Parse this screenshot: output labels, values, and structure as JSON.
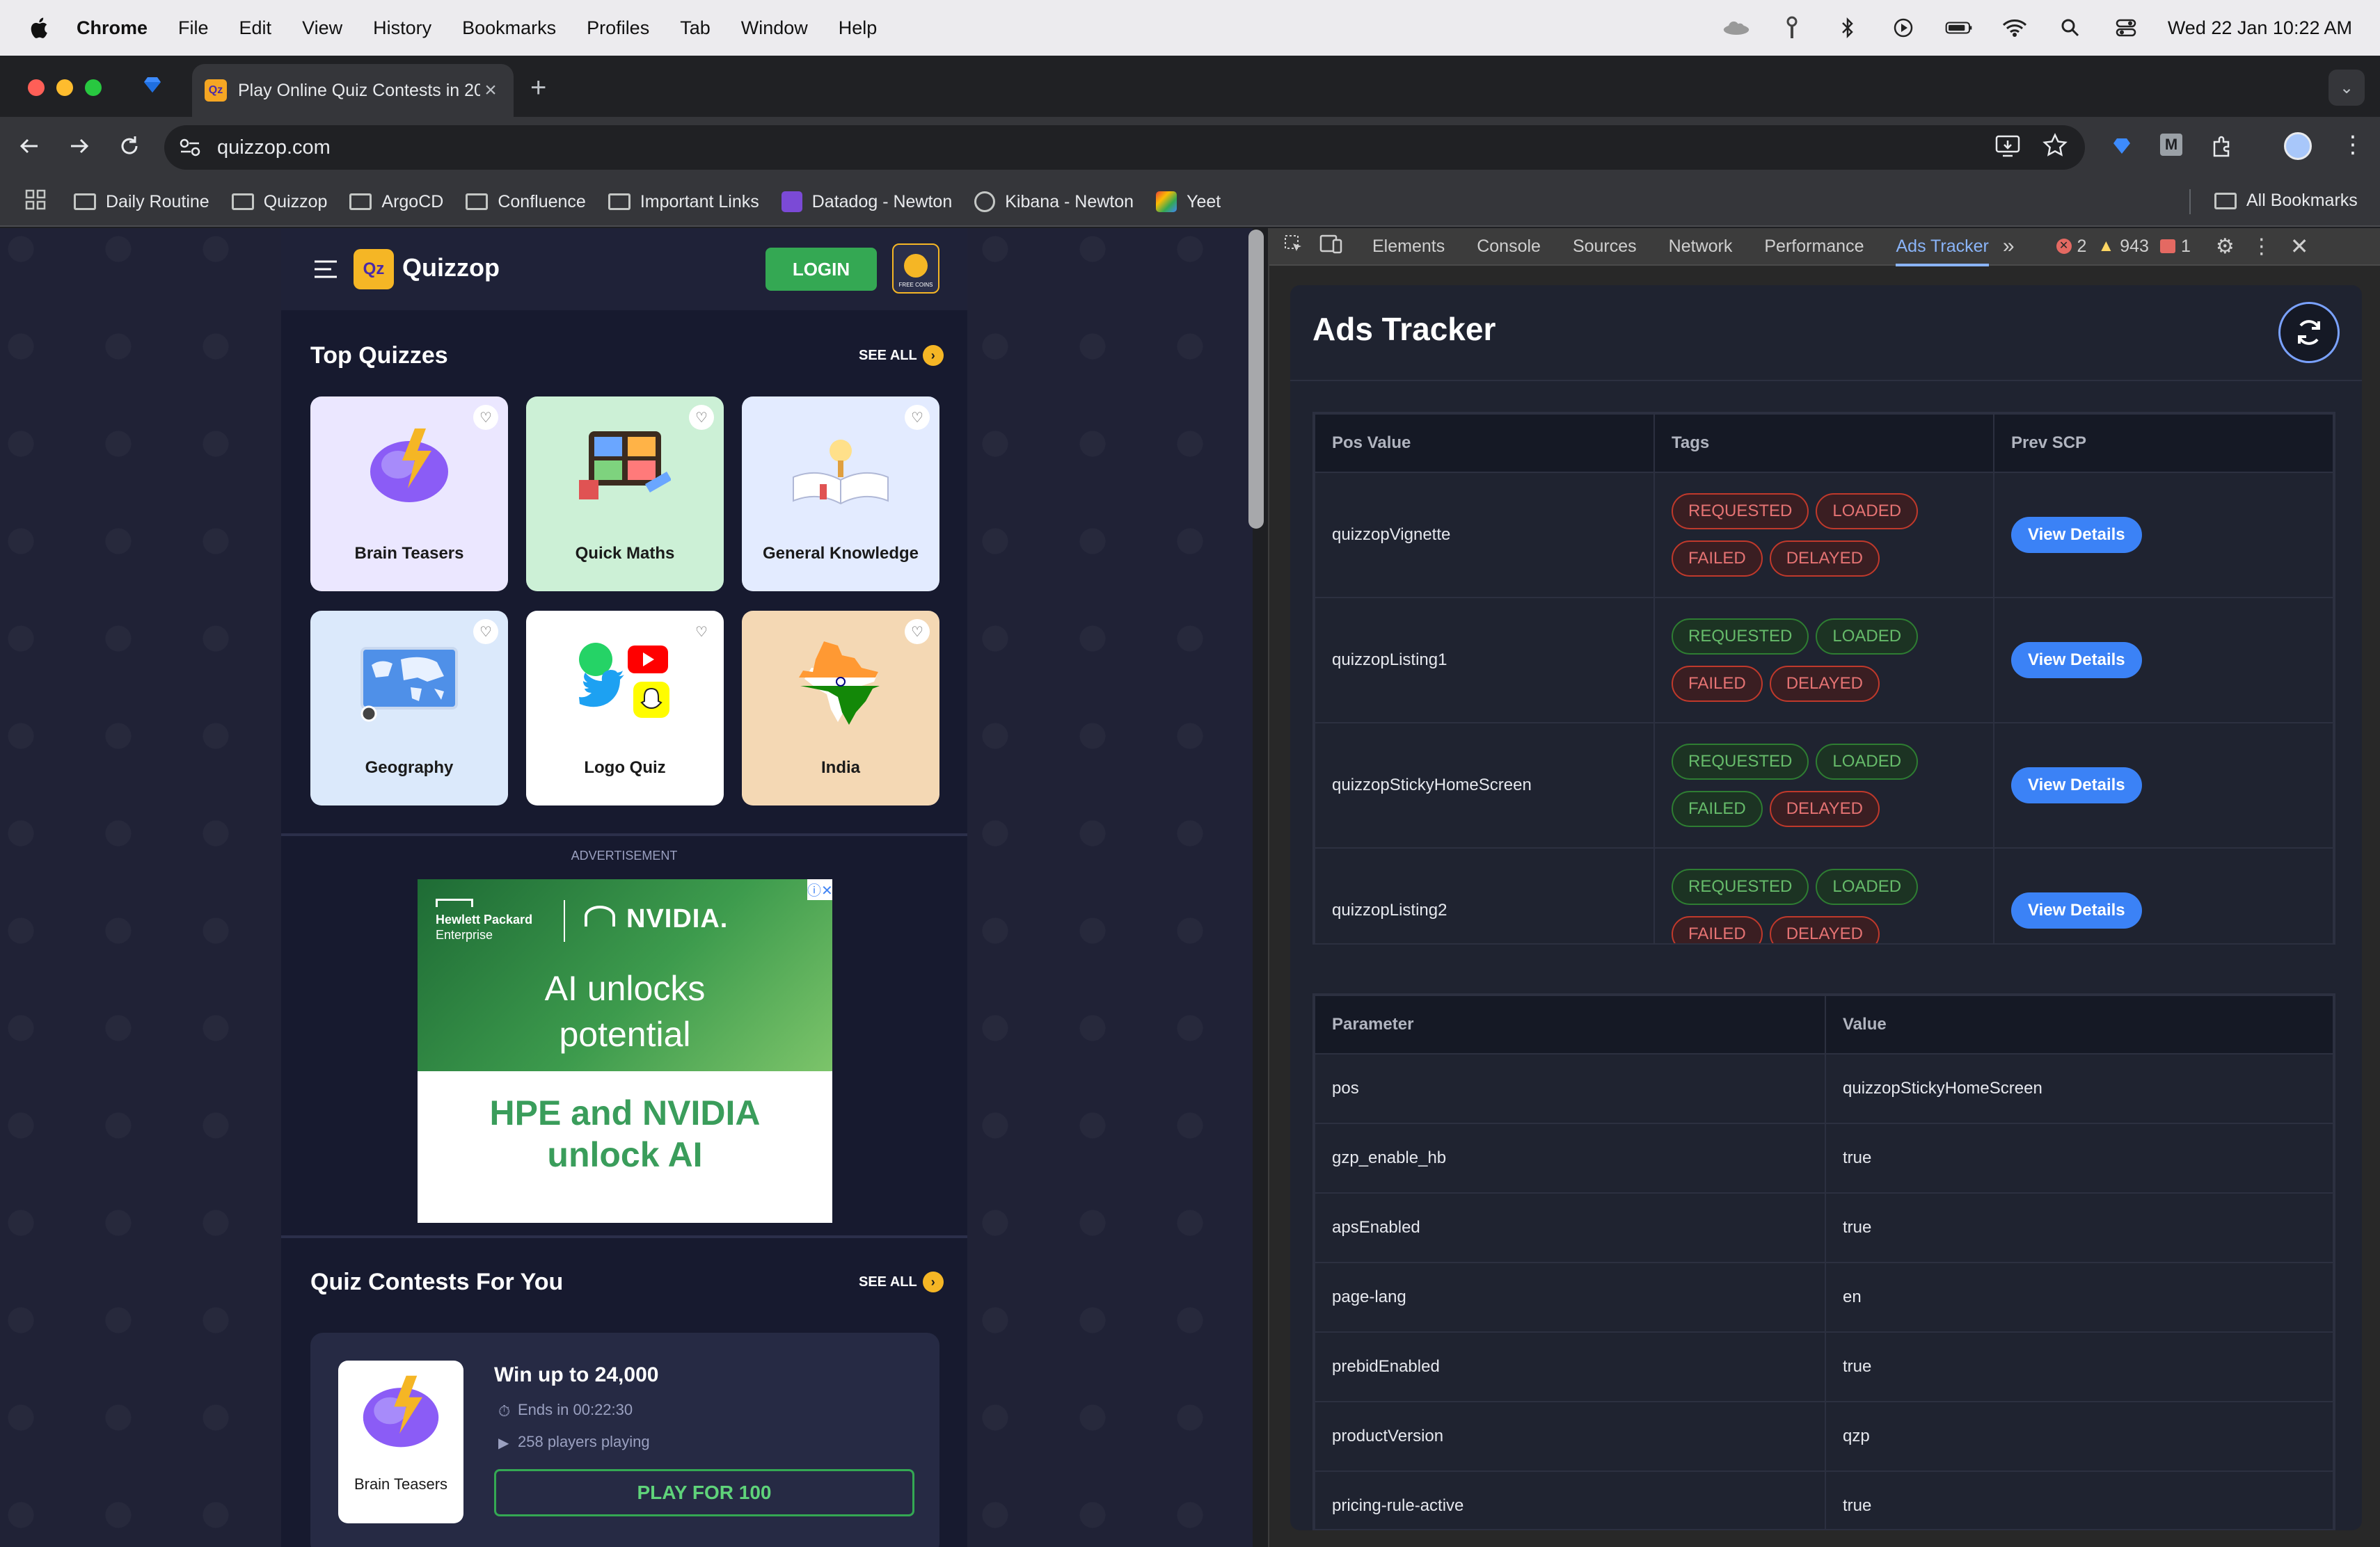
{
  "menubar": {
    "items": [
      "Chrome",
      "File",
      "Edit",
      "View",
      "History",
      "Bookmarks",
      "Profiles",
      "Tab",
      "Window",
      "Help"
    ],
    "datetime": "Wed 22 Jan  10:22 AM"
  },
  "browser": {
    "tab_title": "Play Online Quiz Contests in 20",
    "url": "quizzop.com",
    "bookmarks": [
      "Daily Routine",
      "Quizzop",
      "ArgoCD",
      "Confluence",
      "Important Links",
      "Datadog - Newton",
      "Kibana - Newton",
      "Yeet"
    ],
    "all_bookmarks": "All Bookmarks"
  },
  "quizzop": {
    "brand": "Quizzop",
    "login": "LOGIN",
    "coins_label": "FREE COINS",
    "top_quizzes_title": "Top Quizzes",
    "see_all": "SEE ALL",
    "quizzes": [
      "Brain Teasers",
      "Quick Maths",
      "General Knowledge",
      "Geography",
      "Logo Quiz",
      "India"
    ],
    "ad_label": "ADVERTISEMENT",
    "ad": {
      "brand1_line1": "Hewlett Packard",
      "brand1_line2": "Enterprise",
      "brand2": "NVIDIA.",
      "headline": "AI unlocks potential",
      "tagline": "HPE and NVIDIA unlock AI"
    },
    "contests_title": "Quiz Contests For You",
    "contest": {
      "category": "Brain Teasers",
      "prize": "Win up to 24,000",
      "ends": "Ends in 00:22:30",
      "players": "258 players playing",
      "play_btn": "PLAY FOR 100"
    }
  },
  "devtools": {
    "tabs": [
      "Elements",
      "Console",
      "Sources",
      "Network",
      "Performance",
      "Ads Tracker"
    ],
    "active_tab": "Ads Tracker",
    "errors": "2",
    "warnings": "943",
    "issues": "1",
    "panel_title": "Ads Tracker",
    "table1": {
      "headers": [
        "Pos Value",
        "Tags",
        "Prev SCP"
      ],
      "view_details": "View Details",
      "rows": [
        {
          "pos": "quizzopVignette",
          "tags": [
            {
              "t": "REQUESTED",
              "c": "red"
            },
            {
              "t": "LOADED",
              "c": "red"
            },
            {
              "t": "FAILED",
              "c": "red"
            },
            {
              "t": "DELAYED",
              "c": "red"
            }
          ]
        },
        {
          "pos": "quizzopListing1",
          "tags": [
            {
              "t": "REQUESTED",
              "c": "green"
            },
            {
              "t": "LOADED",
              "c": "green"
            },
            {
              "t": "FAILED",
              "c": "red"
            },
            {
              "t": "DELAYED",
              "c": "red"
            }
          ]
        },
        {
          "pos": "quizzopStickyHomeScreen",
          "tags": [
            {
              "t": "REQUESTED",
              "c": "green"
            },
            {
              "t": "LOADED",
              "c": "green"
            },
            {
              "t": "FAILED",
              "c": "green"
            },
            {
              "t": "DELAYED",
              "c": "red"
            }
          ]
        },
        {
          "pos": "quizzopListing2",
          "tags": [
            {
              "t": "REQUESTED",
              "c": "green"
            },
            {
              "t": "LOADED",
              "c": "green"
            },
            {
              "t": "FAILED",
              "c": "red"
            },
            {
              "t": "DELAYED",
              "c": "red"
            }
          ]
        }
      ]
    },
    "table2": {
      "headers": [
        "Parameter",
        "Value"
      ],
      "rows": [
        [
          "pos",
          "quizzopStickyHomeScreen"
        ],
        [
          "gzp_enable_hb",
          "true"
        ],
        [
          "apsEnabled",
          "true"
        ],
        [
          "page-lang",
          "en"
        ],
        [
          "prebidEnabled",
          "true"
        ],
        [
          "productVersion",
          "qzp"
        ],
        [
          "pricing-rule-active",
          "true"
        ]
      ]
    }
  }
}
